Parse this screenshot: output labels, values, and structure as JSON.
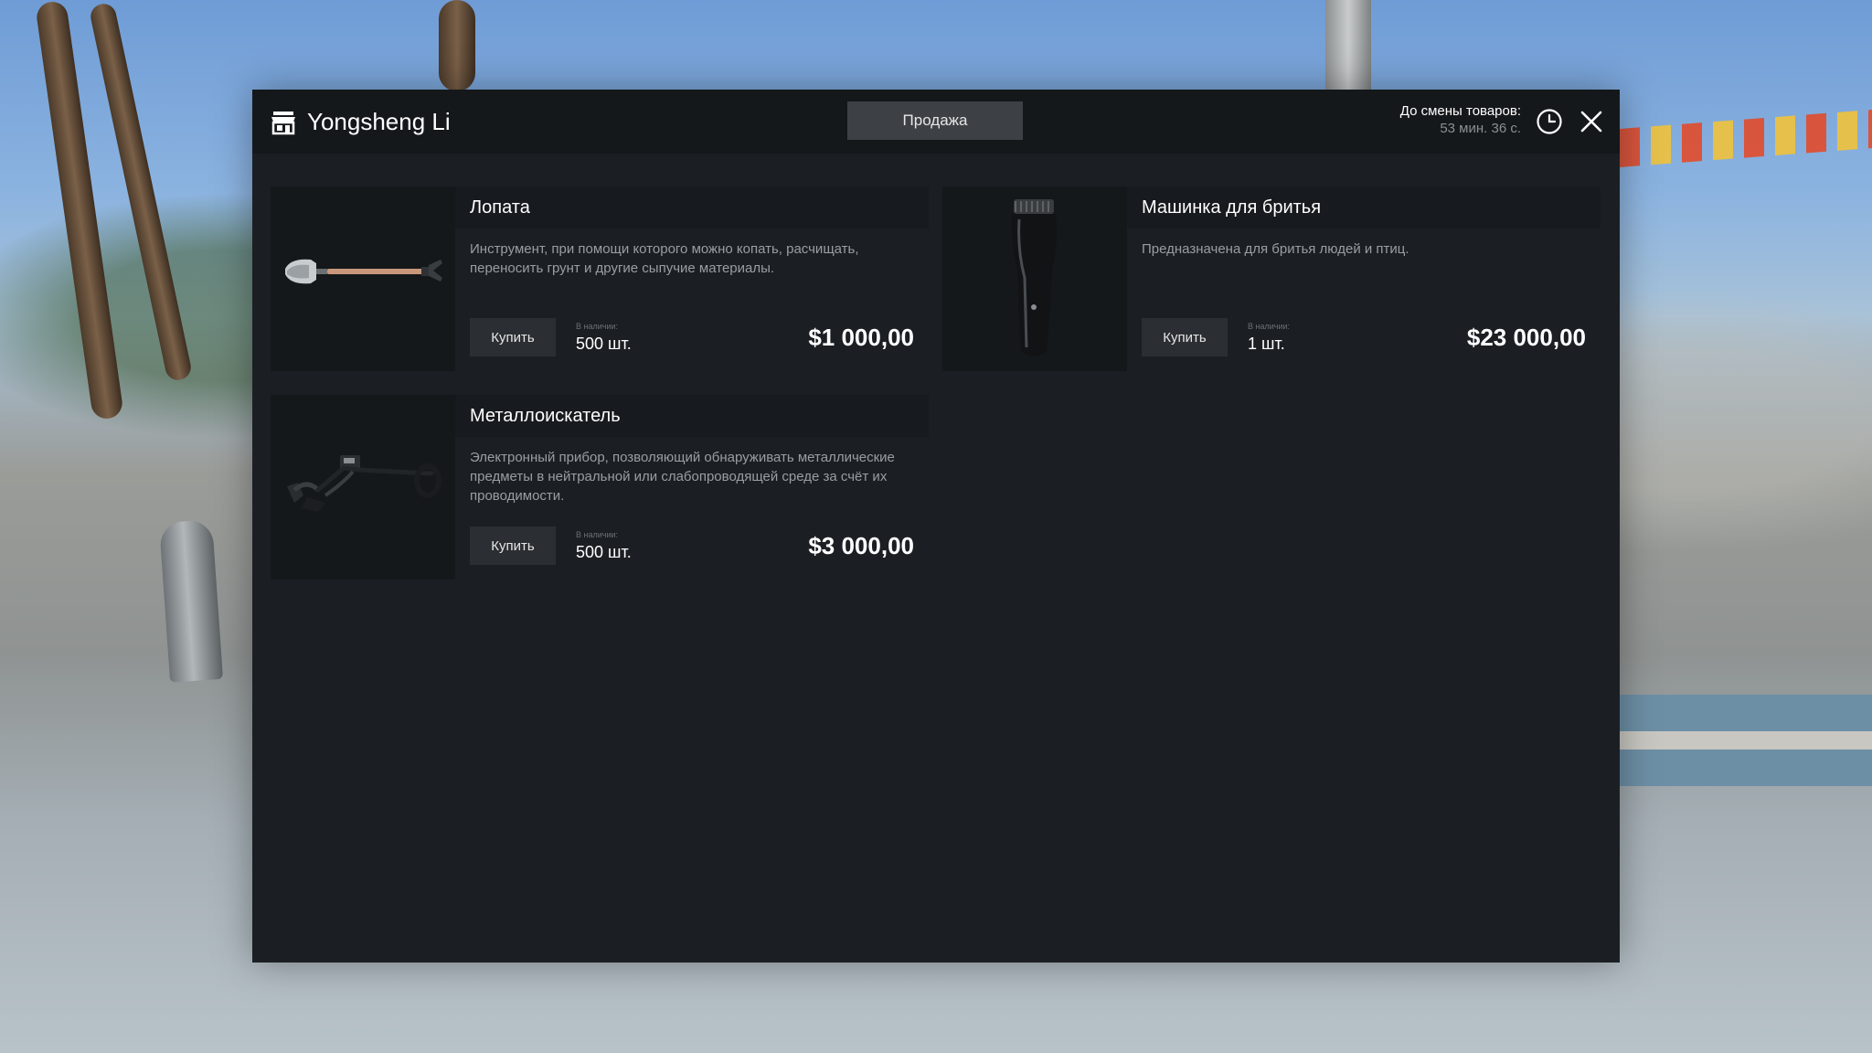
{
  "header": {
    "shop_icon": "shop-icon",
    "shop_name": "Yongsheng Li",
    "tab_sell": "Продажа",
    "timer_label": "До смены товаров:",
    "timer_value": "53 мин. 36 с.",
    "clock_icon": "clock-icon",
    "close_icon": "close-icon"
  },
  "colors": {
    "panel_bg": "#1b1f23",
    "header_bg": "#15181b",
    "tab_bg": "#3d4145",
    "button_bg": "#2b2f33",
    "text_primary": "#ffffff",
    "text_muted": "#9a9ea2"
  },
  "items": [
    {
      "title": "Лопата",
      "description": "Инструмент, при помощи которого можно копать, расчищать, переносить грунт и другие сыпучие материалы.",
      "buy_label": "Купить",
      "stock_label": "В наличии:",
      "stock": "500 шт.",
      "price": "$1 000,00",
      "image": "shovel"
    },
    {
      "title": "Машинка для бритья",
      "description": "Предназначена для бритья людей и птиц.",
      "buy_label": "Купить",
      "stock_label": "В наличии:",
      "stock": "1 шт.",
      "price": "$23 000,00",
      "image": "hair-clipper"
    },
    {
      "title": "Металлоискатель",
      "description": "Электронный прибор, позволяющий обнаруживать металлические предметы в нейтральной или слабопроводящей среде за счёт их проводимости.",
      "buy_label": "Купить",
      "stock_label": "В наличии:",
      "stock": "500 шт.",
      "price": "$3 000,00",
      "image": "metal-detector"
    }
  ]
}
